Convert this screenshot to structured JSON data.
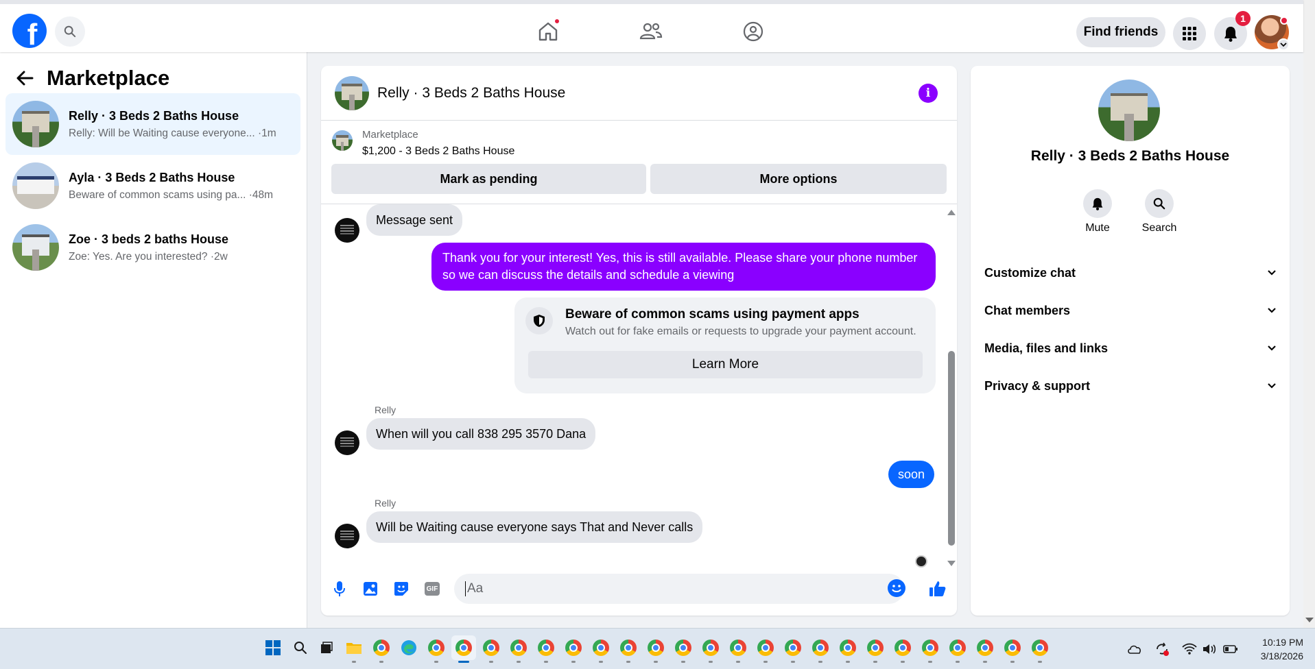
{
  "topbar": {
    "logo_letter": "f",
    "find_friends_label": "Find friends",
    "notification_count": "1",
    "icons": [
      "facebook-logo",
      "search-icon",
      "home-icon",
      "friends-icon",
      "groups-icon",
      "grid-menu-icon",
      "bell-icon",
      "profile-avatar"
    ]
  },
  "sidebar": {
    "title": "Marketplace",
    "conversations": [
      {
        "name": "Relly · 3 Beds 2 Baths House",
        "preview": "Relly: Will be Waiting cause everyone...",
        "time": "·1m"
      },
      {
        "name": "Ayla · 3 Beds 2 Baths House",
        "preview": "Beware of common scams using pa...",
        "time": "·48m"
      },
      {
        "name": "Zoe · 3 beds 2 baths House",
        "preview": "Zoe: Yes. Are you interested?",
        "time": "·2w"
      }
    ]
  },
  "chat": {
    "title": "Relly · 3 Beds 2 Baths House",
    "info_label": "i",
    "listing": {
      "source": "Marketplace",
      "price_title": "$1,200 - 3 Beds 2 Baths House"
    },
    "mark_pending_label": "Mark as pending",
    "more_options_label": "More options",
    "messages": {
      "m1": "Message sent",
      "m2": "Thank you for your interest! Yes, this is still available. Please share your phone number so we can discuss the details and schedule a viewing",
      "scam_title": "Beware of common scams using payment apps",
      "scam_sub": "Watch out for fake emails or requests to upgrade your payment account.",
      "learn_more": "Learn More",
      "sender1": "Relly",
      "m3": "When will you call 838 295 3570 Dana",
      "m4": "soon",
      "sender2": "Relly",
      "m5": "Will be Waiting cause everyone says That and Never calls"
    },
    "composer": {
      "placeholder": "Aa",
      "gif_label": "GIF"
    }
  },
  "right_panel": {
    "name": "Relly · 3 Beds 2 Baths House",
    "mute_label": "Mute",
    "search_label": "Search",
    "sections": [
      "Customize chat",
      "Chat members",
      "Media, files and links",
      "Privacy & support"
    ]
  },
  "taskbar": {
    "time": "10:19 PM",
    "date": "3/18/2026"
  },
  "colors": {
    "facebook_blue": "#0866ff",
    "purple_bubble": "#8a00ff",
    "blue_bubble": "#0866ff",
    "badge_red": "#e41e3f"
  }
}
